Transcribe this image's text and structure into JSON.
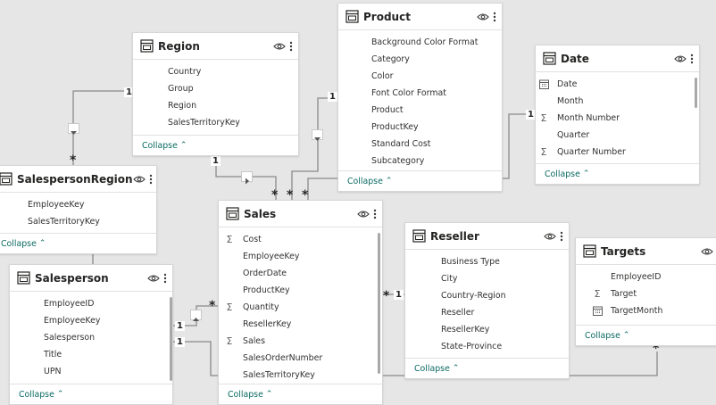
{
  "tables": {
    "product": {
      "title": "Product",
      "icon": "table-icon",
      "fields": [
        {
          "name": "Background Color Format",
          "icon": ""
        },
        {
          "name": "Category",
          "icon": ""
        },
        {
          "name": "Color",
          "icon": ""
        },
        {
          "name": "Font Color Format",
          "icon": ""
        },
        {
          "name": "Product",
          "icon": ""
        },
        {
          "name": "ProductKey",
          "icon": ""
        },
        {
          "name": "Standard Cost",
          "icon": ""
        },
        {
          "name": "Subcategory",
          "icon": ""
        }
      ],
      "collapse": "Collapse"
    },
    "region": {
      "title": "Region",
      "icon": "table-icon",
      "fields": [
        {
          "name": "Country",
          "icon": ""
        },
        {
          "name": "Group",
          "icon": ""
        },
        {
          "name": "Region",
          "icon": ""
        },
        {
          "name": "SalesTerritoryKey",
          "icon": ""
        }
      ],
      "collapse": "Collapse"
    },
    "date": {
      "title": "Date",
      "icon": "table-icon",
      "fields": [
        {
          "name": "Date",
          "icon": "calendar"
        },
        {
          "name": "Month",
          "icon": ""
        },
        {
          "name": "Month Number",
          "icon": "sigma"
        },
        {
          "name": "Quarter",
          "icon": ""
        },
        {
          "name": "Quarter Number",
          "icon": "sigma"
        }
      ],
      "collapse": "Collapse"
    },
    "salesperson_region": {
      "title": "SalespersonRegion",
      "icon": "table-icon",
      "fields": [
        {
          "name": "EmployeeKey",
          "icon": ""
        },
        {
          "name": "SalesTerritoryKey",
          "icon": ""
        }
      ],
      "collapse": "Collapse"
    },
    "sales": {
      "title": "Sales",
      "icon": "table-icon",
      "fields": [
        {
          "name": "Cost",
          "icon": "sigma"
        },
        {
          "name": "EmployeeKey",
          "icon": ""
        },
        {
          "name": "OrderDate",
          "icon": ""
        },
        {
          "name": "ProductKey",
          "icon": ""
        },
        {
          "name": "Quantity",
          "icon": "sigma"
        },
        {
          "name": "ResellerKey",
          "icon": ""
        },
        {
          "name": "Sales",
          "icon": "sigma"
        },
        {
          "name": "SalesOrderNumber",
          "icon": ""
        },
        {
          "name": "SalesTerritoryKey",
          "icon": ""
        }
      ],
      "collapse": "Collapse"
    },
    "reseller": {
      "title": "Reseller",
      "icon": "table-icon",
      "fields": [
        {
          "name": "Business Type",
          "icon": ""
        },
        {
          "name": "City",
          "icon": ""
        },
        {
          "name": "Country-Region",
          "icon": ""
        },
        {
          "name": "Reseller",
          "icon": ""
        },
        {
          "name": "ResellerKey",
          "icon": ""
        },
        {
          "name": "State-Province",
          "icon": ""
        }
      ],
      "collapse": "Collapse"
    },
    "targets": {
      "title": "Targets",
      "icon": "table-icon",
      "fields": [
        {
          "name": "EmployeeID",
          "icon": ""
        },
        {
          "name": "Target",
          "icon": "sigma"
        },
        {
          "name": "TargetMonth",
          "icon": "calendar"
        }
      ],
      "collapse": "Collapse"
    },
    "salesperson": {
      "title": "Salesperson",
      "icon": "table-icon",
      "fields": [
        {
          "name": "EmployeeID",
          "icon": ""
        },
        {
          "name": "EmployeeKey",
          "icon": ""
        },
        {
          "name": "Salesperson",
          "icon": ""
        },
        {
          "name": "Title",
          "icon": ""
        },
        {
          "name": "UPN",
          "icon": ""
        }
      ],
      "collapse": "Collapse"
    }
  },
  "cardinality": {
    "one": "1",
    "many": "*"
  },
  "colors": {
    "canvas": "#e6e6e6",
    "line": "#8a8a8a",
    "collapse_link": "#0b6a62"
  }
}
